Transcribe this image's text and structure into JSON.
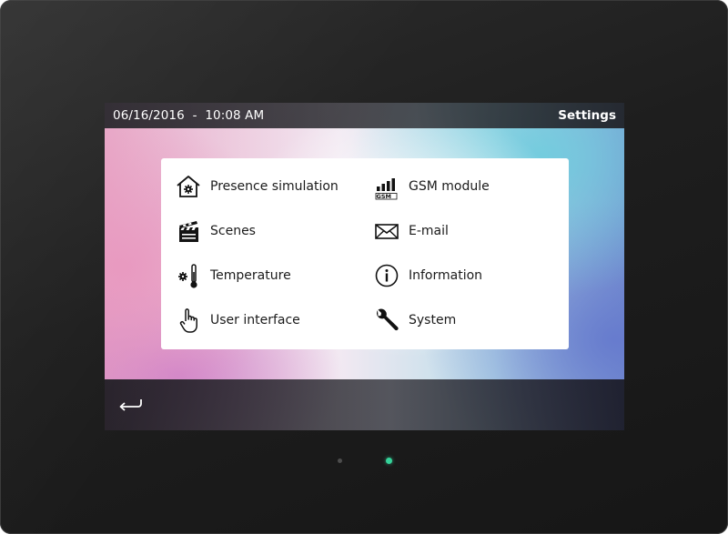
{
  "status_bar": {
    "datetime": "06/16/2016  -  10:08 AM",
    "title": "Settings"
  },
  "menu": {
    "left": [
      {
        "label": "Presence simulation",
        "icon": "house-gear-icon"
      },
      {
        "label": "Scenes",
        "icon": "clapperboard-icon"
      },
      {
        "label": "Temperature",
        "icon": "thermometer-gear-icon"
      },
      {
        "label": "User interface",
        "icon": "hand-pointer-icon"
      }
    ],
    "right": [
      {
        "label": "GSM module",
        "icon": "signal-bars-gsm-icon",
        "icon_text": "GSM"
      },
      {
        "label": "E-mail",
        "icon": "envelope-icon"
      },
      {
        "label": "Information",
        "icon": "info-circle-icon"
      },
      {
        "label": "System",
        "icon": "wrench-icon"
      }
    ]
  },
  "bottom_bar": {
    "back_icon": "return-arrow-icon"
  },
  "colors": {
    "bezel": "#1e1e1e",
    "status_led": "#35d39a",
    "panel": "#ffffff",
    "text": "#1a1a1a"
  }
}
